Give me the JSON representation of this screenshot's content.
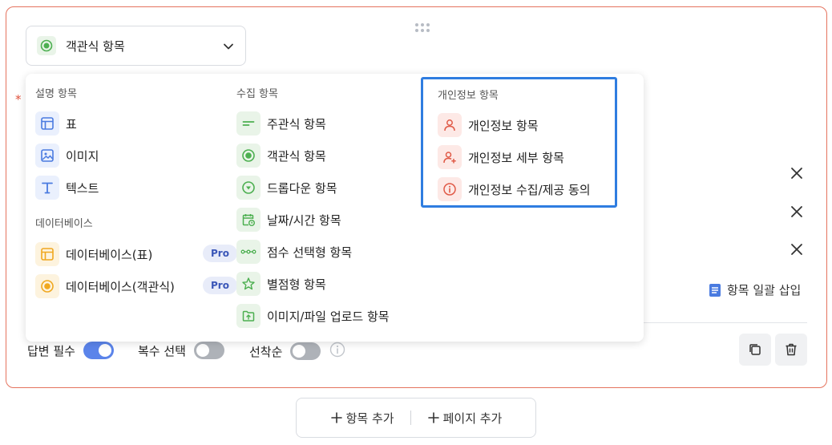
{
  "question_type": {
    "selected": "객관식 항목"
  },
  "required_marker": "*",
  "dropdown": {
    "sections": [
      {
        "title": "설명 항목",
        "items": [
          {
            "label": "표",
            "icon": "table-icon"
          },
          {
            "label": "이미지",
            "icon": "image-icon"
          },
          {
            "label": "텍스트",
            "icon": "text-icon"
          }
        ]
      },
      {
        "title": "데이터베이스",
        "items": [
          {
            "label": "데이터베이스(표)",
            "badge": "Pro",
            "icon": "database-table-icon"
          },
          {
            "label": "데이터베이스(객관식)",
            "badge": "Pro",
            "icon": "database-radio-icon"
          }
        ]
      },
      {
        "title": "수집 항목",
        "items": [
          {
            "label": "주관식 항목",
            "icon": "short-answer-icon"
          },
          {
            "label": "객관식 항목",
            "icon": "radio-icon"
          },
          {
            "label": "드롭다운 항목",
            "icon": "dropdown-icon"
          },
          {
            "label": "날짜/시간 항목",
            "icon": "calendar-clock-icon"
          },
          {
            "label": "점수 선택형 항목",
            "icon": "score-scale-icon"
          },
          {
            "label": "별점형 항목",
            "icon": "star-icon"
          },
          {
            "label": "이미지/파일 업로드 항목",
            "icon": "folder-upload-icon"
          }
        ]
      },
      {
        "title": "개인정보 항목",
        "items": [
          {
            "label": "개인정보 항목",
            "icon": "person-icon"
          },
          {
            "label": "개인정보 세부 항목",
            "icon": "person-add-icon"
          },
          {
            "label": "개인정보 수집/제공 동의",
            "icon": "info-circle-icon"
          }
        ]
      }
    ]
  },
  "bulk_insert": "항목 일괄 삽입",
  "toggles": [
    {
      "label": "답변 필수",
      "on": true
    },
    {
      "label": "복수 선택",
      "on": false
    },
    {
      "label": "선착순",
      "on": false
    }
  ],
  "footer": {
    "add_item": "항목 추가",
    "add_page": "페이지 추가"
  },
  "colors": {
    "accent": "#5b84ea",
    "card_border": "#e5735e",
    "highlight": "#2f7de0",
    "green": "#4caf50",
    "red": "#e05a47",
    "yellow": "#f5b42a"
  }
}
